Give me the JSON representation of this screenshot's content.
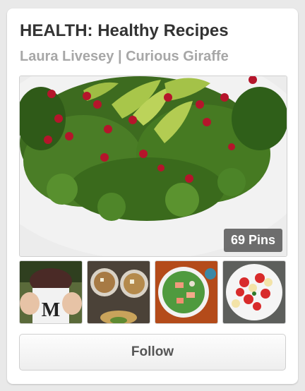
{
  "board": {
    "title": "HEALTH: Healthy Recipes",
    "owner": "Laura Livesey | Curious Giraffe",
    "pin_count_label": "69 Pins",
    "follow_label": "Follow"
  },
  "colors": {
    "title": "#333333",
    "subtitle": "#a7a7a7",
    "pin_badge_bg": "#505050",
    "follow_text": "#555555"
  },
  "images": {
    "cover": "kale-avocado-pomegranate-salad",
    "thumbnails": [
      "chocolate-smoothie-cup",
      "soup-bowls",
      "salmon-salad-plate",
      "strawberry-banana-bowl"
    ]
  }
}
